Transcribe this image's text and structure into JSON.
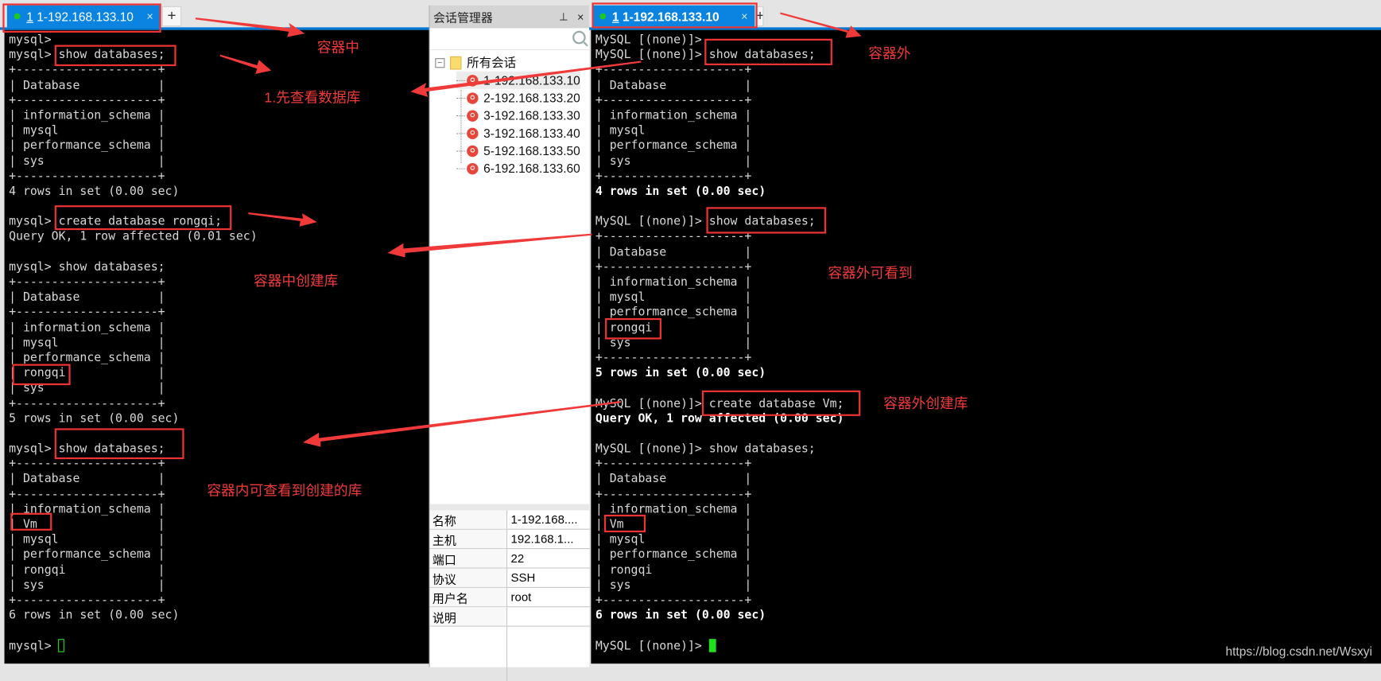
{
  "left_window": {
    "tab": {
      "index": "1",
      "title": "1-192.168.133.10",
      "close": "×",
      "add": "+"
    },
    "lines": [
      "mysql>",
      "mysql> show databases;",
      "+--------------------+",
      "| Database           |",
      "+--------------------+",
      "| information_schema |",
      "| mysql              |",
      "| performance_schema |",
      "| sys                |",
      "+--------------------+",
      "4 rows in set (0.00 sec)",
      "",
      "mysql> create database rongqi;",
      "Query OK, 1 row affected (0.01 sec)",
      "",
      "mysql> show databases;",
      "+--------------------+",
      "| Database           |",
      "+--------------------+",
      "| information_schema |",
      "| mysql              |",
      "| performance_schema |",
      "| rongqi             |",
      "| sys                |",
      "+--------------------+",
      "5 rows in set (0.00 sec)",
      "",
      "mysql> show databases;",
      "+--------------------+",
      "| Database           |",
      "+--------------------+",
      "| information_schema |",
      "| Vm                 |",
      "| mysql              |",
      "| performance_schema |",
      "| rongqi             |",
      "| sys                |",
      "+--------------------+",
      "6 rows in set (0.00 sec)",
      "",
      "mysql> "
    ]
  },
  "session_manager": {
    "title": "会话管理器",
    "pin": "⊥",
    "close": "×",
    "search_placeholder": "",
    "root": "所有会话",
    "sessions": [
      "1-192.168.133.10",
      "2-192.168.133.20",
      "3-192.168.133.30",
      "3-192.168.133.40",
      "5-192.168.133.50",
      "6-192.168.133.60"
    ],
    "properties": [
      {
        "key": "名称",
        "value": "1-192.168...."
      },
      {
        "key": "主机",
        "value": "192.168.1..."
      },
      {
        "key": "端口",
        "value": "22"
      },
      {
        "key": "协议",
        "value": "SSH"
      },
      {
        "key": "用户名",
        "value": "root"
      },
      {
        "key": "说明",
        "value": ""
      }
    ]
  },
  "right_window": {
    "tab": {
      "index": "1",
      "title": "1-192.168.133.10",
      "close": "×",
      "add": "+"
    },
    "lines": [
      "MySQL [(none)]>",
      "MySQL [(none)]> show databases;",
      "+--------------------+",
      "| Database           |",
      "+--------------------+",
      "| information_schema |",
      "| mysql              |",
      "| performance_schema |",
      "| sys                |",
      "+--------------------+",
      "4 rows in set (0.00 sec)",
      "",
      "MySQL [(none)]> show databases;",
      "+--------------------+",
      "| Database           |",
      "+--------------------+",
      "| information_schema |",
      "| mysql              |",
      "| performance_schema |",
      "| rongqi             |",
      "| sys                |",
      "+--------------------+",
      "5 rows in set (0.00 sec)",
      "",
      "MySQL [(none)]> create database Vm;",
      "Query OK, 1 row affected (0.00 sec)",
      "",
      "MySQL [(none)]> show databases;",
      "+--------------------+",
      "| Database           |",
      "+--------------------+",
      "| information_schema |",
      "| Vm                 |",
      "| mysql              |",
      "| performance_schema |",
      "| rongqi             |",
      "| sys                |",
      "+--------------------+",
      "6 rows in set (0.00 sec)",
      "",
      "MySQL [(none)]> "
    ],
    "bold_lines": [
      10,
      22,
      25,
      38
    ]
  },
  "annotations": {
    "in_container": "容器中",
    "step1": "1.先查看数据库",
    "create_in_container": "容器中创建库",
    "view_in_container": "容器内可查看到创建的库",
    "outside_container": "容器外",
    "visible_outside": "容器外可看到",
    "create_outside": "容器外创建库"
  },
  "watermark": "https://blog.csdn.net/Wsxyi",
  "colors": {
    "annotation": "#f03a3a",
    "tab_active": "#0a84e0",
    "cursor": "#1ee01e"
  }
}
